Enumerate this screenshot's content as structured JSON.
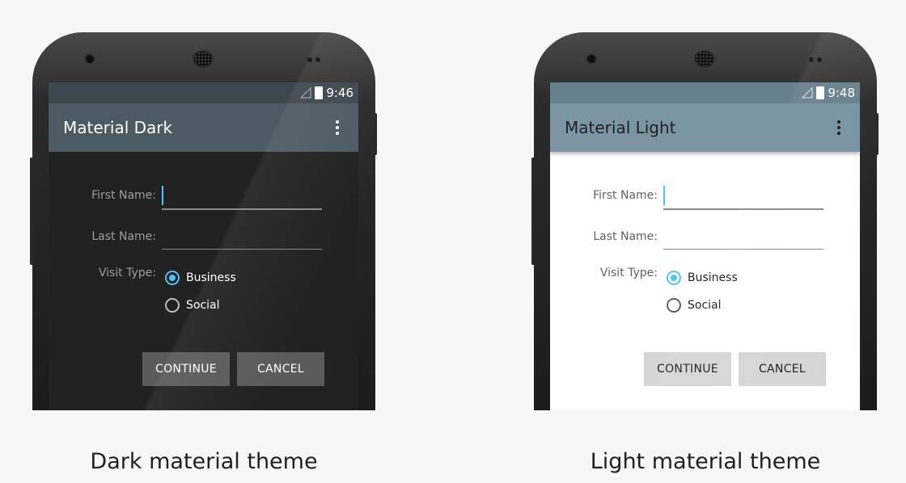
{
  "dark": {
    "status_time": "9:46",
    "title": "Material Dark",
    "first_name_label": "First Name:",
    "last_name_label": "Last Name:",
    "visit_type_label": "Visit Type:",
    "options": [
      "Business",
      "Social"
    ],
    "selected_option": "Business",
    "continue_label": "CONTINUE",
    "cancel_label": "CANCEL",
    "caption": "Dark material theme",
    "colors": {
      "appbar": "#4c5a63",
      "background": "#212121",
      "accent": "#4fc3f7"
    }
  },
  "light": {
    "status_time": "9:48",
    "title": "Material Light",
    "first_name_label": "First Name:",
    "last_name_label": "Last Name:",
    "visit_type_label": "Visit Type:",
    "options": [
      "Business",
      "Social"
    ],
    "selected_option": "Business",
    "continue_label": "CONTINUE",
    "cancel_label": "CANCEL",
    "caption": "Light material theme",
    "colors": {
      "appbar": "#7b96a2",
      "background": "#ffffff",
      "accent": "#4fc3f7"
    }
  },
  "icons": [
    "signal-icon",
    "battery-charging-icon",
    "overflow-menu-icon"
  ]
}
